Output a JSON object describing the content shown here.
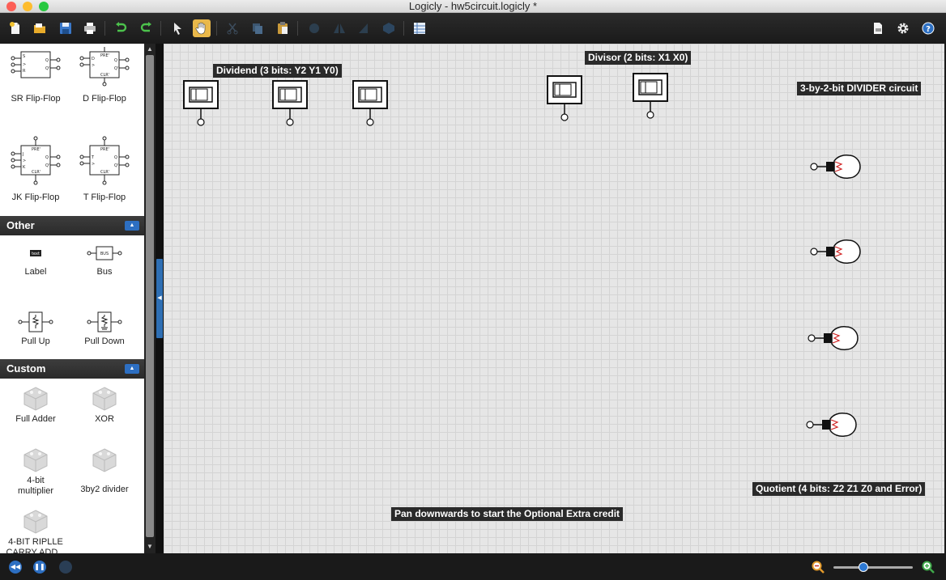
{
  "window": {
    "title": "Logicly - hw5circuit.logicly *",
    "traffic_colors": [
      "#fc5f57",
      "#fdbc2e",
      "#28c840"
    ]
  },
  "toolbar": {
    "icons": [
      "new-file-icon",
      "open-folder-icon",
      "save-icon",
      "print-icon",
      "undo-icon",
      "redo-icon",
      "select-pointer-icon",
      "pan-hand-icon",
      "cut-icon",
      "copy-icon",
      "paste-icon",
      "rotate-icon",
      "flip-horizontal-icon",
      "flip-vertical-icon",
      "bring-front-icon",
      "table-icon",
      "export-icon",
      "settings-gear-icon",
      "help-icon"
    ],
    "active_tool": "pan-hand-icon"
  },
  "sidebar": {
    "flip_flops": [
      {
        "label": "SR Flip-Flop"
      },
      {
        "label": "D Flip-Flop"
      },
      {
        "label": "JK Flip-Flop"
      },
      {
        "label": "T Flip-Flop"
      }
    ],
    "other_header": "Other",
    "other": [
      {
        "label": "Label",
        "glyph": "text"
      },
      {
        "label": "Bus",
        "glyph": "BUS"
      },
      {
        "label": "Pull Up"
      },
      {
        "label": "Pull Down"
      }
    ],
    "custom_header": "Custom",
    "custom": [
      {
        "label": "Full Adder"
      },
      {
        "label": "XOR"
      },
      {
        "label": "4-bit multiplier"
      },
      {
        "label": "3by2 divider"
      },
      {
        "label": "4-BIT RIPLLE CARRY ADD..."
      }
    ]
  },
  "canvas": {
    "labels": {
      "dividend": "Dividend (3 bits: Y2 Y1 Y0)",
      "divisor": "Divisor (2 bits: X1 X0)",
      "circuit": "3-by-2-bit DIVIDER circuit",
      "quotient": "Quotient (4 bits: Z2 Z1 Z0 and Error)",
      "pan": "Pan downwards to start the Optional Extra credit"
    },
    "dividend_switch_count": 3,
    "divisor_switch_count": 2,
    "output_bulb_count": 4
  },
  "statusbar": {
    "zoom_level": 0.38,
    "accent": "#2d6fc2"
  }
}
